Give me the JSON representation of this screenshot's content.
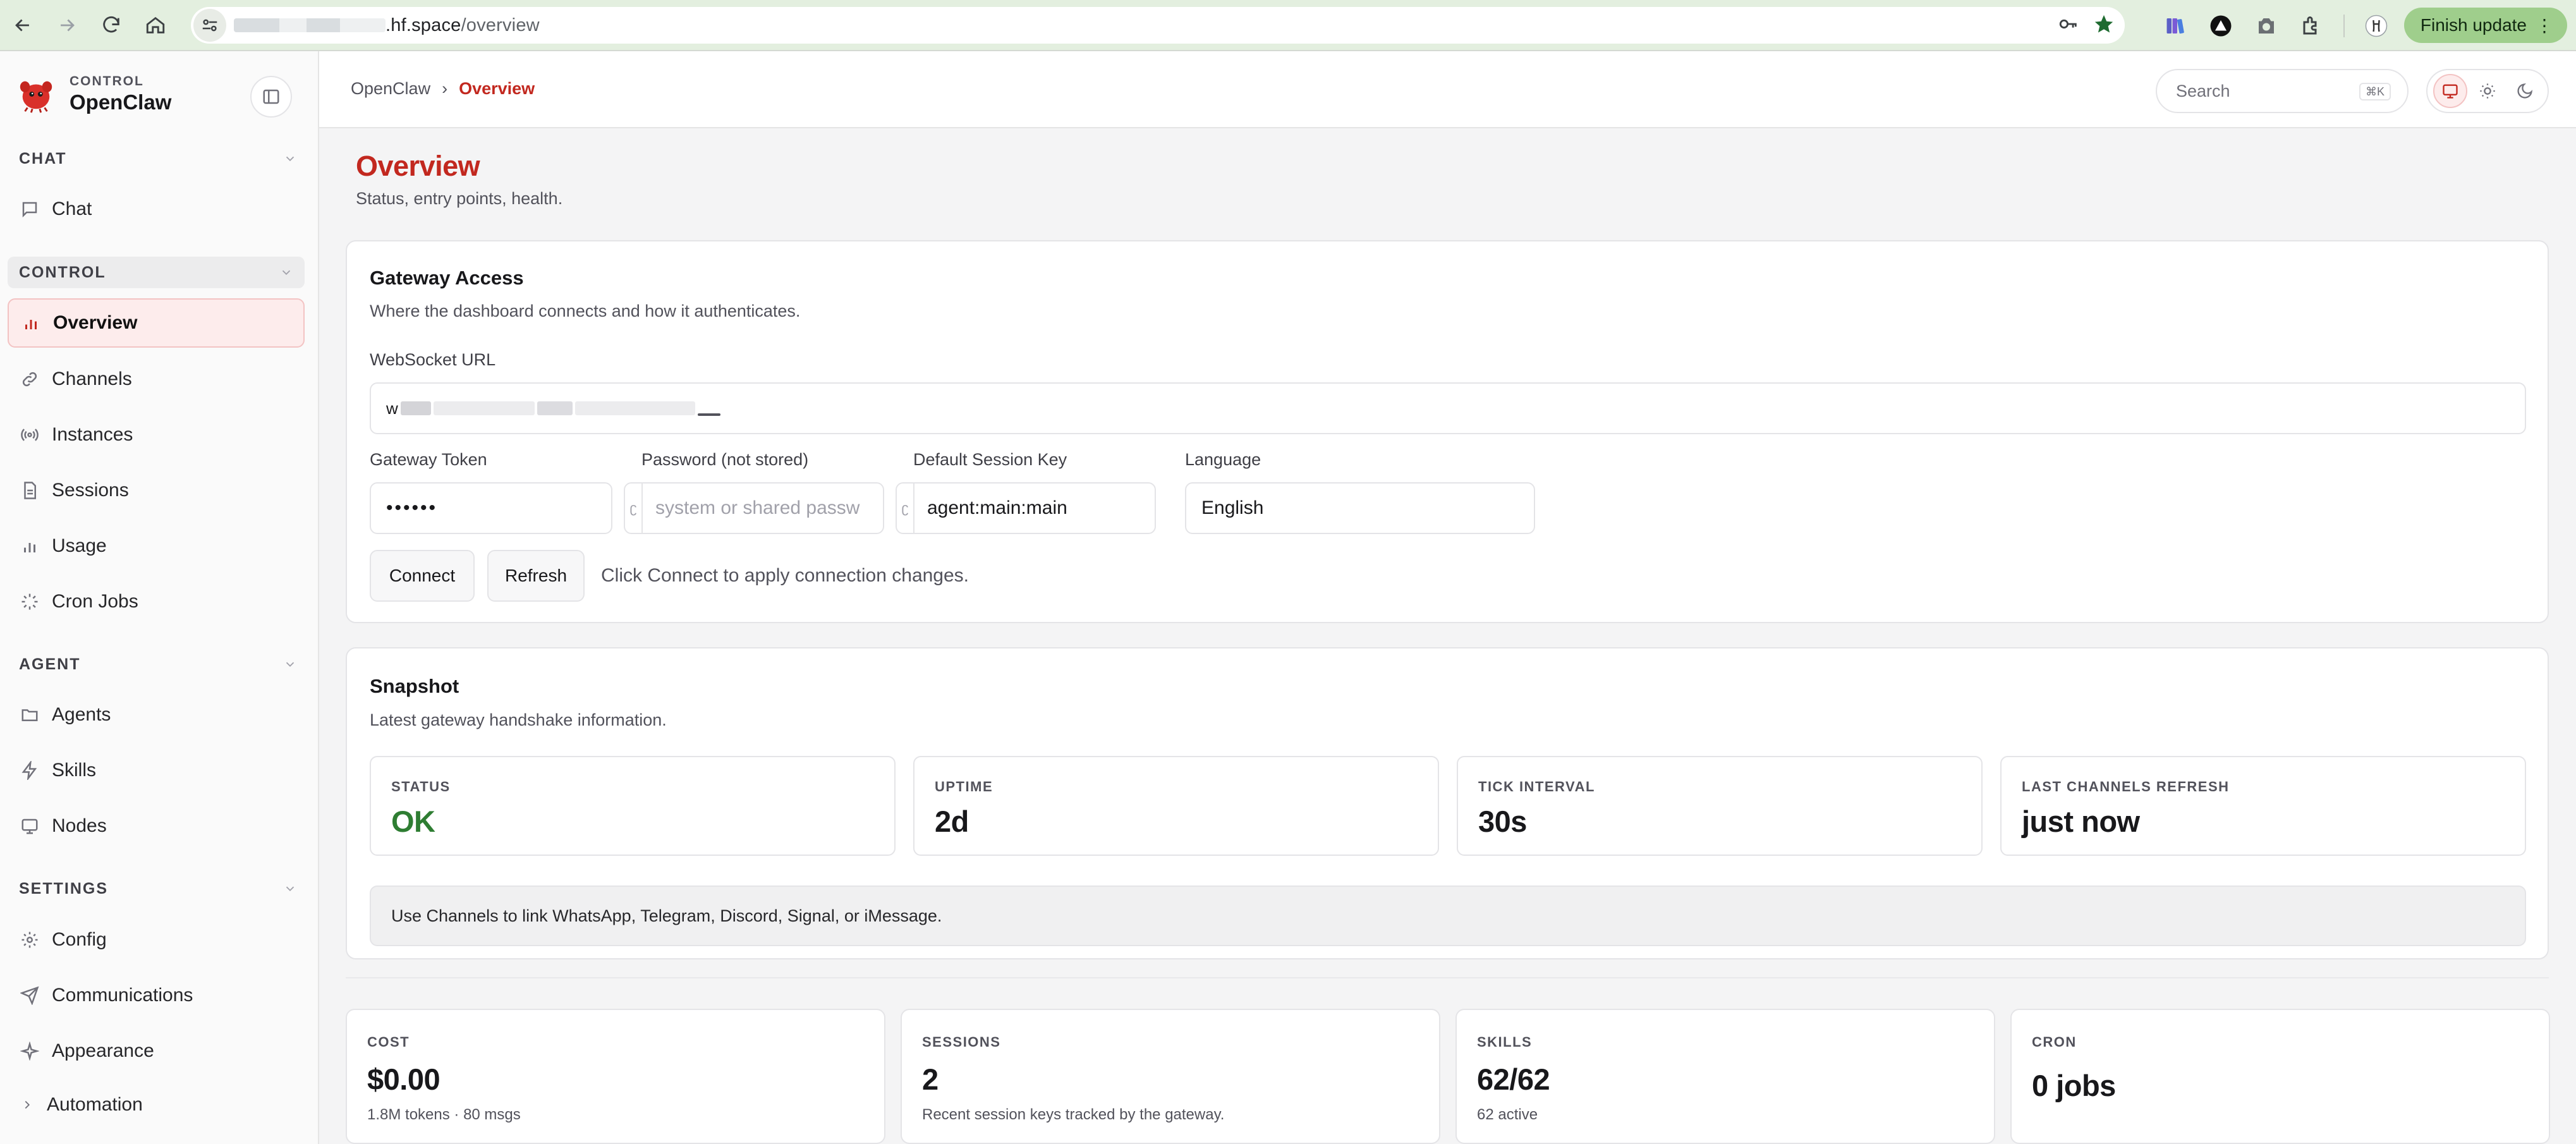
{
  "browser": {
    "url_host": ".hf.space",
    "url_path": "/overview",
    "finish_update_label": "Finish update"
  },
  "sidebar": {
    "brand_sub": "CONTROL",
    "brand_name": "OpenClaw",
    "sections": [
      {
        "label": "CHAT",
        "items": [
          {
            "label": "Chat",
            "icon": "message-square-icon"
          }
        ]
      },
      {
        "label": "CONTROL",
        "items": [
          {
            "label": "Overview",
            "icon": "bar-chart-icon",
            "selected": true
          },
          {
            "label": "Channels",
            "icon": "link-icon"
          },
          {
            "label": "Instances",
            "icon": "radio-icon"
          },
          {
            "label": "Sessions",
            "icon": "file-text-icon"
          },
          {
            "label": "Usage",
            "icon": "bar-chart-icon"
          },
          {
            "label": "Cron Jobs",
            "icon": "loader-icon"
          }
        ]
      },
      {
        "label": "AGENT",
        "items": [
          {
            "label": "Agents",
            "icon": "folder-icon"
          },
          {
            "label": "Skills",
            "icon": "zap-icon"
          },
          {
            "label": "Nodes",
            "icon": "monitor-icon"
          }
        ]
      },
      {
        "label": "SETTINGS",
        "items": [
          {
            "label": "Config",
            "icon": "gear-icon"
          },
          {
            "label": "Communications",
            "icon": "send-icon"
          },
          {
            "label": "Appearance",
            "icon": "sparkle-icon"
          },
          {
            "label": "Automation",
            "icon": "chevron-right-icon"
          }
        ]
      }
    ]
  },
  "topbar": {
    "breadcrumb_root": "OpenClaw",
    "breadcrumb_sep": "›",
    "breadcrumb_current": "Overview",
    "search_placeholder": "Search",
    "search_shortcut": "⌘K"
  },
  "page": {
    "title": "Overview",
    "subtitle": "Status, entry points, health."
  },
  "gateway": {
    "title": "Gateway Access",
    "subtitle": "Where the dashboard connects and how it authenticates.",
    "ws_label": "WebSocket URL",
    "ws_value_start": "w",
    "token_label": "Gateway Token",
    "token_value": "••••••",
    "password_label": "Password (not stored)",
    "password_placeholder": "system or shared passw",
    "session_key_label": "Default Session Key",
    "session_key_value": "agent:main:main",
    "language_label": "Language",
    "language_value": "English",
    "connect_label": "Connect",
    "refresh_label": "Refresh",
    "hint": "Click Connect to apply connection changes."
  },
  "snapshot": {
    "title": "Snapshot",
    "subtitle": "Latest gateway handshake information.",
    "stats": [
      {
        "label": "STATUS",
        "value": "OK",
        "color": "#2e7d32"
      },
      {
        "label": "UPTIME",
        "value": "2d"
      },
      {
        "label": "TICK INTERVAL",
        "value": "30s"
      },
      {
        "label": "LAST CHANNELS REFRESH",
        "value": "just now"
      }
    ],
    "callout": "Use Channels to link WhatsApp, Telegram, Discord, Signal, or iMessage."
  },
  "metrics": [
    {
      "label": "COST",
      "value": "$0.00",
      "sub": "1.8M tokens · 80 msgs"
    },
    {
      "label": "SESSIONS",
      "value": "2",
      "sub": "Recent session keys tracked by the gateway."
    },
    {
      "label": "SKILLS",
      "value": "62/62",
      "sub": "62 active"
    },
    {
      "label": "CRON",
      "value": "0 jobs",
      "sub": ""
    }
  ],
  "colors": {
    "accent": "#c2281f",
    "ok": "#2e7d32",
    "chrome_bg": "#e3efdf",
    "finish_update_bg": "#9fce8c"
  }
}
